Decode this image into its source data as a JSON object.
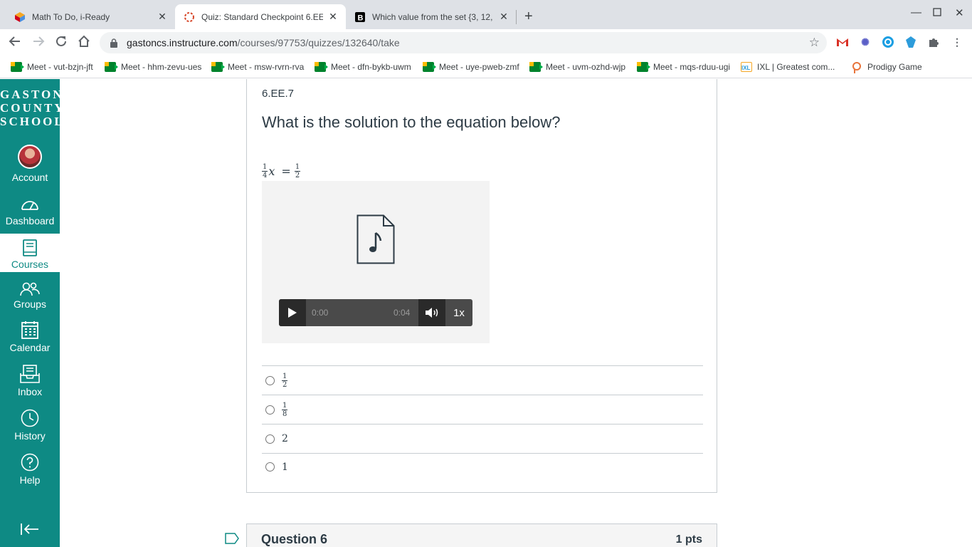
{
  "browser": {
    "tabs": [
      {
        "title": "Math To Do, i-Ready",
        "active": false,
        "icon": "iready-icon"
      },
      {
        "title": "Quiz: Standard Checkpoint 6.EE",
        "active": true,
        "icon": "canvas-icon"
      },
      {
        "title": "Which value from the set {3, 12,",
        "active": false,
        "icon": "brainly-icon"
      }
    ],
    "url_domain": "gastoncs.instructure.com",
    "url_path": "/courses/97753/quizzes/132640/take",
    "bookmarks": [
      {
        "label": "Meet - vut-bzjn-jft",
        "icon": "meet-icon"
      },
      {
        "label": "Meet - hhm-zevu-ues",
        "icon": "meet-icon"
      },
      {
        "label": "Meet - msw-rvrn-rva",
        "icon": "meet-icon"
      },
      {
        "label": "Meet - dfn-bykb-uwm",
        "icon": "meet-icon"
      },
      {
        "label": "Meet - uye-pweb-zmf",
        "icon": "meet-icon"
      },
      {
        "label": "Meet - uvm-ozhd-wjp",
        "icon": "meet-icon"
      },
      {
        "label": "Meet - mqs-rduu-ugi",
        "icon": "meet-icon"
      },
      {
        "label": "IXL | Greatest com...",
        "icon": "ixl-icon"
      },
      {
        "label": "Prodigy Game",
        "icon": "prodigy-icon"
      }
    ]
  },
  "global_nav": {
    "logo_lines": [
      "GASTON",
      "COUNTY",
      "SCHOOLS"
    ],
    "items": [
      {
        "label": "Account",
        "icon": "avatar"
      },
      {
        "label": "Dashboard",
        "icon": "dashboard-icon"
      },
      {
        "label": "Courses",
        "icon": "courses-icon",
        "active": true
      },
      {
        "label": "Groups",
        "icon": "groups-icon"
      },
      {
        "label": "Calendar",
        "icon": "calendar-icon"
      },
      {
        "label": "Inbox",
        "icon": "inbox-icon"
      },
      {
        "label": "History",
        "icon": "history-icon"
      },
      {
        "label": "Help",
        "icon": "help-icon"
      }
    ],
    "accent_color": "#0e8a84"
  },
  "question": {
    "code": "6.EE.7",
    "text": "What is the solution to the equation below?",
    "equation": {
      "coef_num": "1",
      "coef_den": "4",
      "variable": "x",
      "equals": "=",
      "rhs_num": "1",
      "rhs_den": "2"
    },
    "media": {
      "current_time": "0:00",
      "duration": "0:04",
      "speed": "1x"
    },
    "answers": [
      {
        "num": "1",
        "den": "2"
      },
      {
        "num": "1",
        "den": "8"
      },
      {
        "value": "2"
      },
      {
        "value": "1"
      }
    ]
  },
  "next_question": {
    "title": "Question 6",
    "points": "1 pts"
  }
}
